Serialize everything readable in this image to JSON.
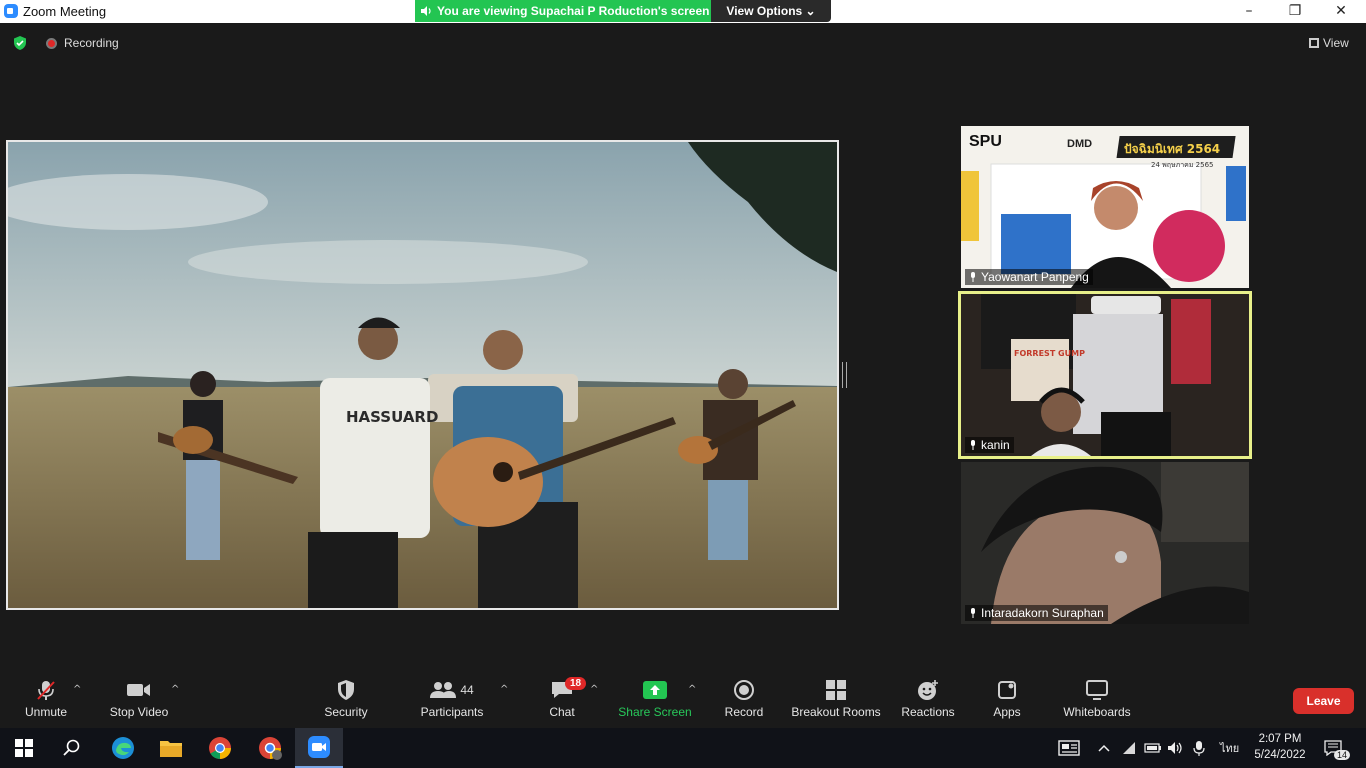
{
  "window": {
    "title": "Zoom Meeting",
    "minimize": "–",
    "restore": "❐",
    "close": "✕"
  },
  "share_banner": {
    "text": "You are viewing Supachai P Roduction's screen",
    "view_options": "View Options ⌄"
  },
  "meeting": {
    "recording_label": "Recording",
    "view_label": "View"
  },
  "participants": [
    {
      "name": "Yaowanart Panpeng",
      "active": false,
      "overlay": {
        "brand1": "SPU",
        "brand2": "DMD",
        "event": "ปัจฉิมนิเทศ 2564",
        "date": "24 พฤษภาคม 2565"
      }
    },
    {
      "name": "kanin",
      "active": true,
      "overlay": {
        "poster": "FORREST GUMP"
      }
    },
    {
      "name": "Intaradakorn Suraphan",
      "active": false
    }
  ],
  "shared_video": {
    "shirt_text": "HASSUARD"
  },
  "toolbar": {
    "unmute": "Unmute",
    "stop_video": "Stop Video",
    "security": "Security",
    "participants": "Participants",
    "participants_count": "44",
    "chat": "Chat",
    "chat_badge": "18",
    "share_screen": "Share Screen",
    "record": "Record",
    "breakout_rooms": "Breakout Rooms",
    "reactions": "Reactions",
    "apps": "Apps",
    "whiteboards": "Whiteboards",
    "leave": "Leave",
    "caret": "^"
  },
  "taskbar": {
    "time": "2:07 PM",
    "date": "5/24/2022",
    "language": "ไทย",
    "notifications": "14"
  },
  "colors": {
    "accent_green": "#23c552",
    "leave_red": "#d9302b",
    "active_outline": "#e8f08a",
    "zoom_blue": "#2d8cff"
  }
}
